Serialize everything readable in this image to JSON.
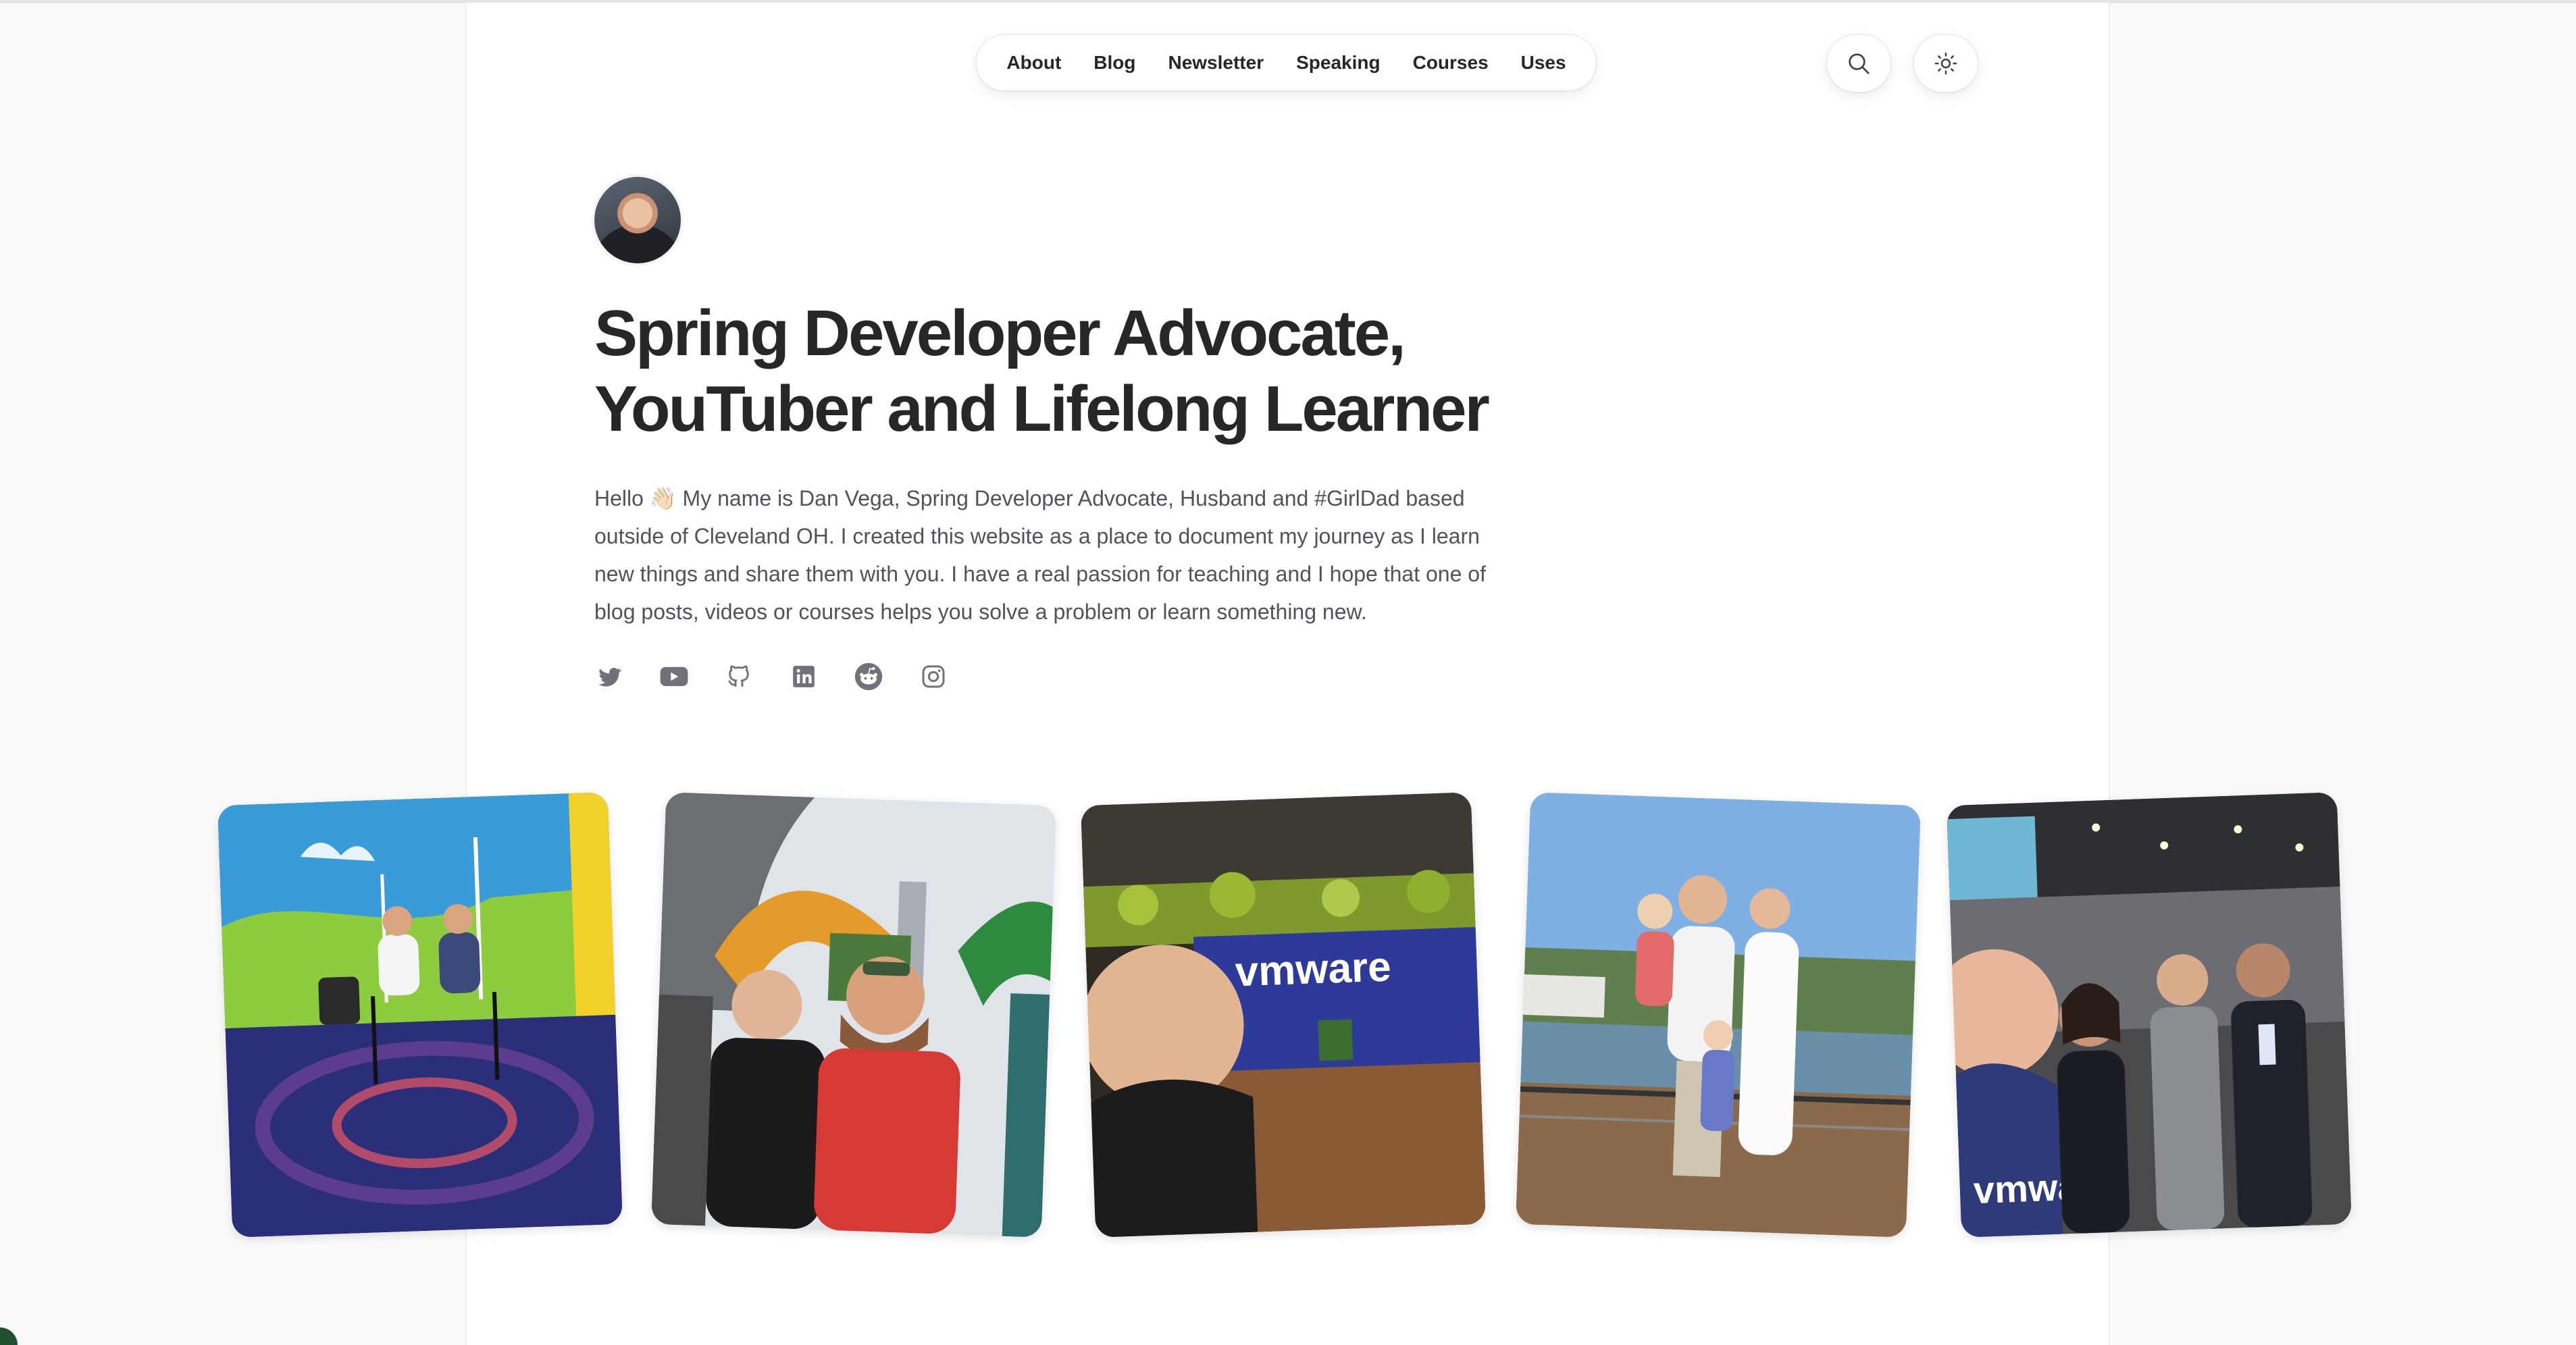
{
  "nav": {
    "items": [
      {
        "label": "About"
      },
      {
        "label": "Blog"
      },
      {
        "label": "Newsletter"
      },
      {
        "label": "Speaking"
      },
      {
        "label": "Courses"
      },
      {
        "label": "Uses"
      }
    ]
  },
  "header_icons": {
    "search": "search-icon",
    "theme": "sun-icon"
  },
  "hero": {
    "title_line1": "Spring Developer Advocate,",
    "title_line2": "YouTuber and Lifelong Learner",
    "bio": "Hello 👋🏻 My name is Dan Vega, Spring Developer Advocate, Husband and #GirlDad based outside of Cleveland OH. I created this website as a place to document my journey as I learn new things and share them with you. I have a real passion for teaching and I hope that one of blog posts, videos or courses helps you solve a problem or learn something new."
  },
  "socials": [
    "twitter-icon",
    "youtube-icon",
    "github-icon",
    "linkedin-icon",
    "reddit-icon",
    "instagram-icon"
  ],
  "photos": [
    {
      "subject": "conference stage interview"
    },
    {
      "subject": "friends outdoors at sculpture"
    },
    {
      "subject": "selfie at vmware office",
      "sign_text": "vmware"
    },
    {
      "subject": "family on waterfront deck"
    },
    {
      "subject": "selfie at expo hall",
      "shirt_text": "vmware"
    }
  ],
  "colors": {
    "text": "#27272a",
    "muted": "#52525b",
    "icon": "#71717a",
    "page_bg": "#fafafa"
  }
}
